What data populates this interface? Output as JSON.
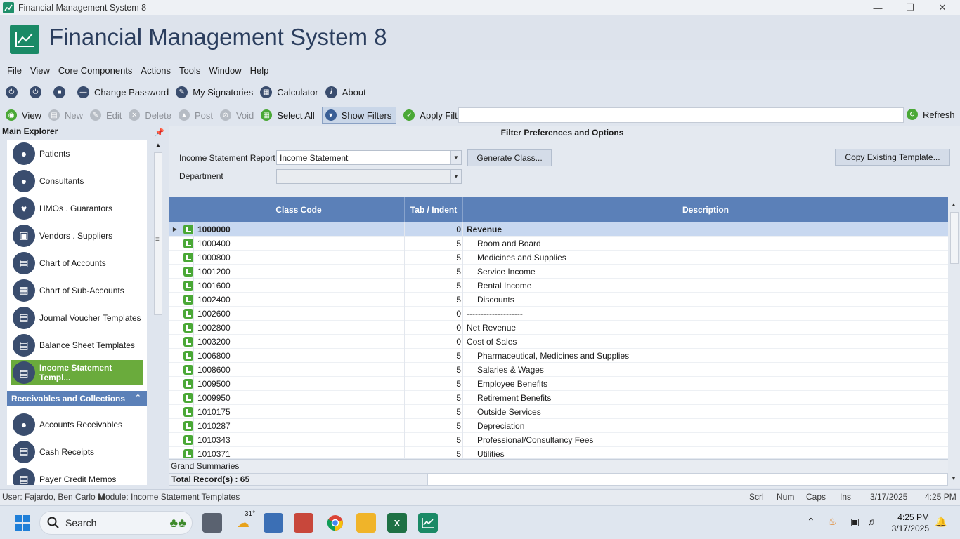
{
  "window": {
    "title": "Financial Management System 8"
  },
  "banner": {
    "title": "Financial Management System 8"
  },
  "menu": [
    "File",
    "View",
    "Core Components",
    "Actions",
    "Tools",
    "Window",
    "Help"
  ],
  "toolbar1": {
    "change_password": "Change Password",
    "my_signatories": "My Signatories",
    "calculator": "Calculator",
    "about": "About"
  },
  "toolbar2": {
    "view": "View",
    "new": "New",
    "edit": "Edit",
    "delete": "Delete",
    "post": "Post",
    "void": "Void",
    "select_all": "Select All",
    "show_filters": "Show Filters",
    "apply_filters": "Apply Filters",
    "filter_value": "",
    "refresh": "Refresh"
  },
  "explorer": {
    "header": "Main Explorer",
    "items": [
      "Patients",
      "Consultants",
      "HMOs . Guarantors",
      "Vendors . Suppliers",
      "Chart of Accounts",
      "Chart of Sub-Accounts",
      "Journal Voucher Templates",
      "Balance Sheet Templates",
      "Income Statement Templ..."
    ],
    "group": "Receivables and Collections",
    "group_items": [
      "Accounts Receivables",
      "Cash Receipts",
      "Payer Credit Memos"
    ]
  },
  "panel": {
    "header": "Filter Preferences and Options",
    "report_label": "Income Statement Report",
    "report_value": "Income Statement",
    "department_label": "Department",
    "department_value": "",
    "generate_btn": "Generate Class...",
    "copy_btn": "Copy Existing Template..."
  },
  "grid": {
    "columns": [
      "Class Code",
      "Tab / Indent",
      "Description"
    ],
    "rows": [
      {
        "code": "1000000",
        "indent": "0",
        "desc": "Revenue"
      },
      {
        "code": "1000400",
        "indent": "5",
        "desc": "Room and Board"
      },
      {
        "code": "1000800",
        "indent": "5",
        "desc": "Medicines and Supplies"
      },
      {
        "code": "1001200",
        "indent": "5",
        "desc": "Service Income"
      },
      {
        "code": "1001600",
        "indent": "5",
        "desc": "Rental Income"
      },
      {
        "code": "1002400",
        "indent": "5",
        "desc": "Discounts"
      },
      {
        "code": "1002600",
        "indent": "0",
        "desc": "--------------------"
      },
      {
        "code": "1002800",
        "indent": "0",
        "desc": "Net Revenue"
      },
      {
        "code": "1003200",
        "indent": "0",
        "desc": "Cost of Sales"
      },
      {
        "code": "1006800",
        "indent": "5",
        "desc": "Pharmaceutical, Medicines and Supplies"
      },
      {
        "code": "1008600",
        "indent": "5",
        "desc": "Salaries & Wages"
      },
      {
        "code": "1009500",
        "indent": "5",
        "desc": "Employee Benefits"
      },
      {
        "code": "1009950",
        "indent": "5",
        "desc": "Retirement Benefits"
      },
      {
        "code": "1010175",
        "indent": "5",
        "desc": "Outside Services"
      },
      {
        "code": "1010287",
        "indent": "5",
        "desc": "Depreciation"
      },
      {
        "code": "1010343",
        "indent": "5",
        "desc": "Professional/Consultancy Fees"
      },
      {
        "code": "1010371",
        "indent": "5",
        "desc": "Utilities"
      }
    ],
    "grand_summaries": "Grand Summaries",
    "total_records": "Total Record(s) : 65"
  },
  "status": {
    "user": "User: Fajardo, Ben Carlo M",
    "module": "Module: Income Statement Templates",
    "scrl": "Scrl",
    "num": "Num",
    "caps": "Caps",
    "ins": "Ins",
    "date": "3/17/2025",
    "time": "4:25 PM"
  },
  "taskbar": {
    "search": "Search",
    "weather": "31°",
    "time": "4:25 PM",
    "date": "3/17/2025"
  }
}
